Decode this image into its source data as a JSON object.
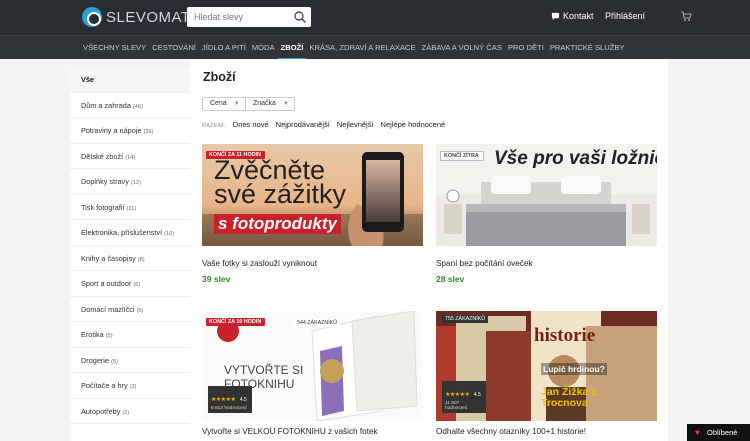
{
  "header": {
    "logo_text": "SLEVOMAT",
    "search_placeholder": "Hledat slevy",
    "contact_label": "Kontakt",
    "login_label": "Přihlášení"
  },
  "nav": {
    "items": [
      {
        "label": "VŠECHNY SLEVY"
      },
      {
        "label": "CESTOVÁNÍ"
      },
      {
        "label": "JÍDLO A PITÍ"
      },
      {
        "label": "MÓDA"
      },
      {
        "label": "ZBOŽÍ"
      },
      {
        "label": "KRÁSA, ZDRAVÍ A RELAXACE"
      },
      {
        "label": "ZÁBAVA A VOLNÝ ČAS"
      },
      {
        "label": "PRO DĚTI"
      },
      {
        "label": "PRAKTICKÉ SLUŽBY"
      }
    ],
    "active_index": 4
  },
  "sidebar": {
    "items": [
      {
        "label": "Vše",
        "count": ""
      },
      {
        "label": "Dům a zahrada",
        "count": "(46)"
      },
      {
        "label": "Potraviny a nápoje",
        "count": "(26)"
      },
      {
        "label": "Dětské zboží",
        "count": "(14)"
      },
      {
        "label": "Doplňky stravy",
        "count": "(12)"
      },
      {
        "label": "Tisk fotografií",
        "count": "(11)"
      },
      {
        "label": "Elektronika, příslušenství",
        "count": "(10)"
      },
      {
        "label": "Knihy a časopisy",
        "count": "(8)"
      },
      {
        "label": "Sport a outdoor",
        "count": "(6)"
      },
      {
        "label": "Domácí mazlíčci",
        "count": "(5)"
      },
      {
        "label": "Erotika",
        "count": "(5)"
      },
      {
        "label": "Drogerie",
        "count": "(5)"
      },
      {
        "label": "Počítače a hry",
        "count": "(3)"
      },
      {
        "label": "Autopotřeby",
        "count": "(2)"
      }
    ]
  },
  "main": {
    "title": "Zboží",
    "filters": {
      "price_label": "Cena",
      "brand_label": "Značka"
    },
    "sort": {
      "label": "ŘAZENÍ:",
      "options": [
        "Dnes nové",
        "Nejprodávanější",
        "Nejlevnější",
        "Nejlépe hodnocené"
      ]
    },
    "cards": [
      {
        "badge": "KONČÍ ZA 11 HODIN",
        "image_text": {
          "line1": "Zvěčněte",
          "line2": "své zážitky",
          "line3": "s fotoprodukty"
        },
        "title": "Vaše fotky si zaslouží vyniknout",
        "deals": "39 slev"
      },
      {
        "badge": "KONČÍ ZÍTRA",
        "image_text": {
          "line1": "Vše pro vaši ložnici"
        },
        "title": "Spaní bez počítání oveček",
        "deals": "28 slev"
      },
      {
        "badge": "KONČÍ ZA 10 HODIN",
        "customers": "544 ZÁKAZNÍKŮ",
        "image_text": {
          "line1": "VYTVOŘTE SI",
          "line2": "FOTOKNIHU"
        },
        "rating": {
          "value": "4.5",
          "count": "8 812 hodnocení"
        },
        "title": "Vytvořte si VELKOU FOTOKNIHU z vašich fotek"
      },
      {
        "customers": "755 ZÁKAZNÍKŮ",
        "image_text": {
          "line1": "historie",
          "line2": "Lupič hrdinou?",
          "line3": "Jan Žižka z Trocnova"
        },
        "rating": {
          "value": "4.5",
          "count": "11 607 hodnocení"
        },
        "title": "Odhalte všechny otazníky 100+1 historie!"
      }
    ]
  },
  "favorites_label": "Oblíbené",
  "colors": {
    "accent": "#2f9fd8",
    "deal_green": "#2f8b26",
    "badge_red": "#c9212c",
    "header_bg": "#2a2d31"
  }
}
